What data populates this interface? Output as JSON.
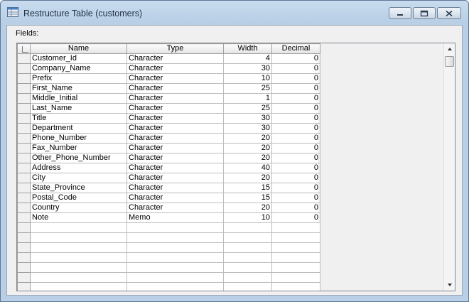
{
  "window": {
    "title": "Restructure Table (customers)"
  },
  "fields_label": "Fields:",
  "columns": {
    "name": "Name",
    "type": "Type",
    "width": "Width",
    "decimal": "Decimal"
  },
  "rows": [
    {
      "name": "Customer_Id",
      "type": "Character",
      "width": "4",
      "decimal": "0"
    },
    {
      "name": "Company_Name",
      "type": "Character",
      "width": "30",
      "decimal": "0"
    },
    {
      "name": "Prefix",
      "type": "Character",
      "width": "10",
      "decimal": "0"
    },
    {
      "name": "First_Name",
      "type": "Character",
      "width": "25",
      "decimal": "0"
    },
    {
      "name": "Middle_Initial",
      "type": "Character",
      "width": "1",
      "decimal": "0"
    },
    {
      "name": "Last_Name",
      "type": "Character",
      "width": "25",
      "decimal": "0"
    },
    {
      "name": "Title",
      "type": "Character",
      "width": "30",
      "decimal": "0"
    },
    {
      "name": "Department",
      "type": "Character",
      "width": "30",
      "decimal": "0"
    },
    {
      "name": "Phone_Number",
      "type": "Character",
      "width": "20",
      "decimal": "0"
    },
    {
      "name": "Fax_Number",
      "type": "Character",
      "width": "20",
      "decimal": "0"
    },
    {
      "name": "Other_Phone_Number",
      "type": "Character",
      "width": "20",
      "decimal": "0"
    },
    {
      "name": "Address",
      "type": "Character",
      "width": "40",
      "decimal": "0"
    },
    {
      "name": "City",
      "type": "Character",
      "width": "20",
      "decimal": "0"
    },
    {
      "name": "State_Province",
      "type": "Character",
      "width": "15",
      "decimal": "0"
    },
    {
      "name": "Postal_Code",
      "type": "Character",
      "width": "15",
      "decimal": "0"
    },
    {
      "name": "Country",
      "type": "Character",
      "width": "20",
      "decimal": "0"
    },
    {
      "name": "Note",
      "type": "Memo",
      "width": "10",
      "decimal": "0"
    }
  ],
  "icons": {
    "minimize": "minimize-icon",
    "maximize": "maximize-icon",
    "close": "close-icon",
    "scroll_up": "arrow-up-icon",
    "scroll_down": "arrow-down-icon"
  }
}
